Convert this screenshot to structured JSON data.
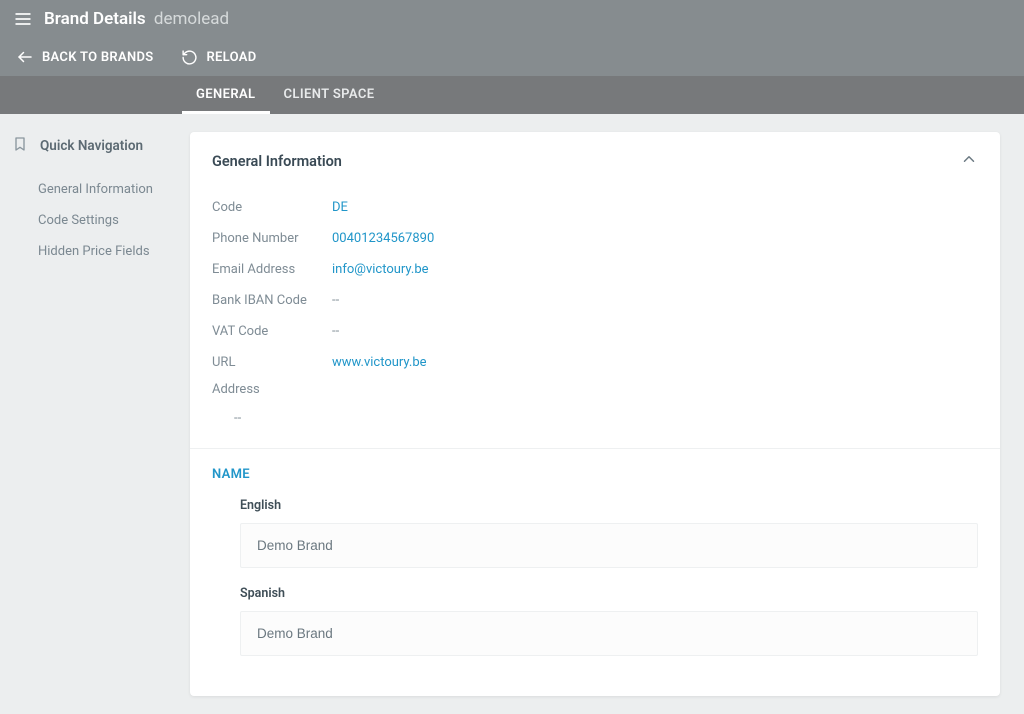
{
  "header": {
    "title": "Brand Details",
    "subtitle": "demolead",
    "back_label": "BACK TO BRANDS",
    "reload_label": "RELOAD"
  },
  "tabs": {
    "general": "GENERAL",
    "client_space": "CLIENT SPACE"
  },
  "sidebar": {
    "heading": "Quick Navigation",
    "items": {
      "general_information": "General Information",
      "code_settings": "Code Settings",
      "hidden_price_fields": "Hidden Price Fields"
    }
  },
  "card": {
    "title": "General Information",
    "fields": {
      "code_label": "Code",
      "code_value": "DE",
      "phone_label": "Phone Number",
      "phone_value": "00401234567890",
      "email_label": "Email Address",
      "email_value": "info@victoury.be",
      "iban_label": "Bank IBAN Code",
      "iban_value": "--",
      "vat_label": "VAT Code",
      "vat_value": "--",
      "url_label": "URL",
      "url_value": "www.victoury.be",
      "address_label": "Address",
      "address_value": "--"
    },
    "name_section": {
      "heading": "NAME",
      "english_label": "English",
      "english_value": "Demo Brand",
      "spanish_label": "Spanish",
      "spanish_value": "Demo Brand"
    }
  }
}
